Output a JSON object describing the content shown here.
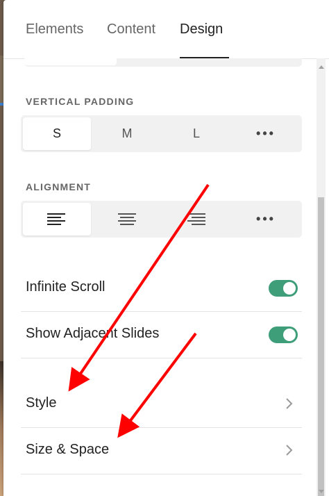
{
  "tabs": [
    {
      "label": "Elements"
    },
    {
      "label": "Content"
    },
    {
      "label": "Design"
    }
  ],
  "vertical_padding": {
    "label": "VERTICAL PADDING",
    "options": [
      "S",
      "M",
      "L"
    ],
    "more": "•••",
    "selected": "S"
  },
  "alignment": {
    "label": "ALIGNMENT",
    "options_icons": [
      "align-left-icon",
      "align-center-icon",
      "align-right-icon"
    ],
    "more": "•••",
    "selected": "align-left-icon"
  },
  "toggles": [
    {
      "label": "Infinite Scroll",
      "on": true
    },
    {
      "label": "Show Adjacent Slides",
      "on": true
    }
  ],
  "nav_rows": [
    {
      "label": "Style"
    },
    {
      "label": "Size & Space"
    }
  ],
  "colors": {
    "toggle_on": "#3f9e7a",
    "annotation_arrow": "#ff0000"
  }
}
